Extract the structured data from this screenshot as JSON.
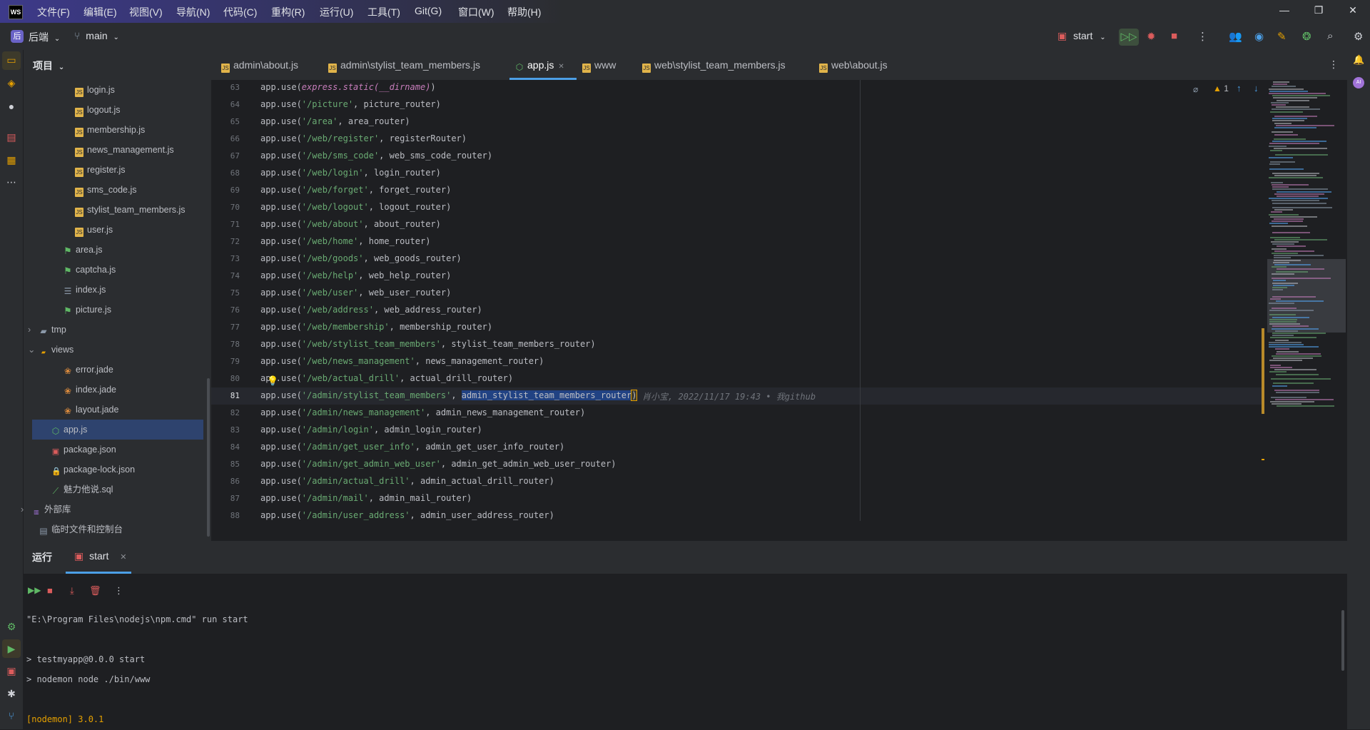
{
  "menu": [
    "文件(F)",
    "编辑(E)",
    "视图(V)",
    "导航(N)",
    "代码(C)",
    "重构(R)",
    "运行(U)",
    "工具(T)",
    "Git(G)",
    "窗口(W)",
    "帮助(H)"
  ],
  "app_logo": "WS",
  "window_controls": {
    "minimize": "—",
    "restore": "❐",
    "close": "✕"
  },
  "toolbar": {
    "project_badge": "后",
    "project_name": "后端",
    "branch": "main",
    "run_config": "start"
  },
  "project_panel": {
    "title": "项目",
    "items": [
      {
        "label": "login.js",
        "type": "js"
      },
      {
        "label": "logout.js",
        "type": "js"
      },
      {
        "label": "membership.js",
        "type": "js"
      },
      {
        "label": "news_management.js",
        "type": "js"
      },
      {
        "label": "register.js",
        "type": "js"
      },
      {
        "label": "sms_code.js",
        "type": "js"
      },
      {
        "label": "stylist_team_members.js",
        "type": "js"
      },
      {
        "label": "user.js",
        "type": "js"
      },
      {
        "label": "area.js",
        "type": "route"
      },
      {
        "label": "captcha.js",
        "type": "route"
      },
      {
        "label": "index.js",
        "type": "list"
      },
      {
        "label": "picture.js",
        "type": "route"
      },
      {
        "label": "tmp",
        "type": "folder"
      },
      {
        "label": "views",
        "type": "folder-open"
      },
      {
        "label": "error.jade",
        "type": "jade"
      },
      {
        "label": "index.jade",
        "type": "jade"
      },
      {
        "label": "layout.jade",
        "type": "jade"
      },
      {
        "label": "app.js",
        "type": "node"
      },
      {
        "label": "package.json",
        "type": "json"
      },
      {
        "label": "package-lock.json",
        "type": "lock"
      },
      {
        "label": "魅力他说.sql",
        "type": "sql"
      },
      {
        "label": "外部库",
        "type": "lib"
      },
      {
        "label": "临时文件和控制台",
        "type": "scratch"
      }
    ]
  },
  "tabs": [
    {
      "label": "admin\\about.js"
    },
    {
      "label": "admin\\stylist_team_members.js"
    },
    {
      "label": "app.js",
      "active": true
    },
    {
      "label": "www"
    },
    {
      "label": "web\\stylist_team_members.js"
    },
    {
      "label": "web\\about.js"
    }
  ],
  "editor": {
    "warning_count": "1",
    "lines": [
      {
        "n": "63",
        "path": "",
        "router": "express.static(__dirname)"
      },
      {
        "n": "64",
        "path": "'/picture'",
        "router": "picture_router"
      },
      {
        "n": "65",
        "path": "'/area'",
        "router": "area_router"
      },
      {
        "n": "66",
        "path": "'/web/register'",
        "router": "registerRouter"
      },
      {
        "n": "67",
        "path": "'/web/sms_code'",
        "router": "web_sms_code_router"
      },
      {
        "n": "68",
        "path": "'/web/login'",
        "router": "login_router"
      },
      {
        "n": "69",
        "path": "'/web/forget'",
        "router": "forget_router"
      },
      {
        "n": "70",
        "path": "'/web/logout'",
        "router": "logout_router"
      },
      {
        "n": "71",
        "path": "'/web/about'",
        "router": "about_router"
      },
      {
        "n": "72",
        "path": "'/web/home'",
        "router": "home_router"
      },
      {
        "n": "73",
        "path": "'/web/goods'",
        "router": "web_goods_router"
      },
      {
        "n": "74",
        "path": "'/web/help'",
        "router": "web_help_router"
      },
      {
        "n": "75",
        "path": "'/web/user'",
        "router": "web_user_router"
      },
      {
        "n": "76",
        "path": "'/web/address'",
        "router": "web_address_router"
      },
      {
        "n": "77",
        "path": "'/web/membership'",
        "router": "membership_router"
      },
      {
        "n": "78",
        "path": "'/web/stylist_team_members'",
        "router": "stylist_team_members_router"
      },
      {
        "n": "79",
        "path": "'/web/news_management'",
        "router": "news_management_router"
      },
      {
        "n": "80",
        "path": "'/web/actual_drill'",
        "router": "actual_drill_router"
      },
      {
        "n": "81",
        "path": "'/admin/stylist_team_members'",
        "router": "admin_stylist_team_members_router"
      },
      {
        "n": "82",
        "path": "'/admin/news_management'",
        "router": "admin_news_management_router"
      },
      {
        "n": "83",
        "path": "'/admin/login'",
        "router": "admin_login_router"
      },
      {
        "n": "84",
        "path": "'/admin/get_user_info'",
        "router": "admin_get_user_info_router"
      },
      {
        "n": "85",
        "path": "'/admin/get_admin_web_user'",
        "router": "admin_get_admin_web_user_router"
      },
      {
        "n": "86",
        "path": "'/admin/actual_drill'",
        "router": "admin_actual_drill_router"
      },
      {
        "n": "87",
        "path": "'/admin/mail'",
        "router": "admin_mail_router"
      },
      {
        "n": "88",
        "path": "'/admin/user_address'",
        "router": "admin_user_address_router"
      }
    ],
    "call_prefix": "app.use(",
    "call_suffix": ")",
    "sep": ", ",
    "blame": "肖小宝, 2022/11/17 19:43 • 我github"
  },
  "run_panel": {
    "title": "运行",
    "tab": "start",
    "console": [
      "\"E:\\Program Files\\nodejs\\npm.cmd\" run start",
      "",
      "> testmyapp@0.0.0 start",
      "> nodemon node ./bin/www",
      "",
      "[nodemon] 3.0.1"
    ]
  },
  "colors": {
    "accent": "#4c9fe6",
    "string": "#6aab73",
    "selection": "#214283",
    "warning": "#e5a000"
  }
}
